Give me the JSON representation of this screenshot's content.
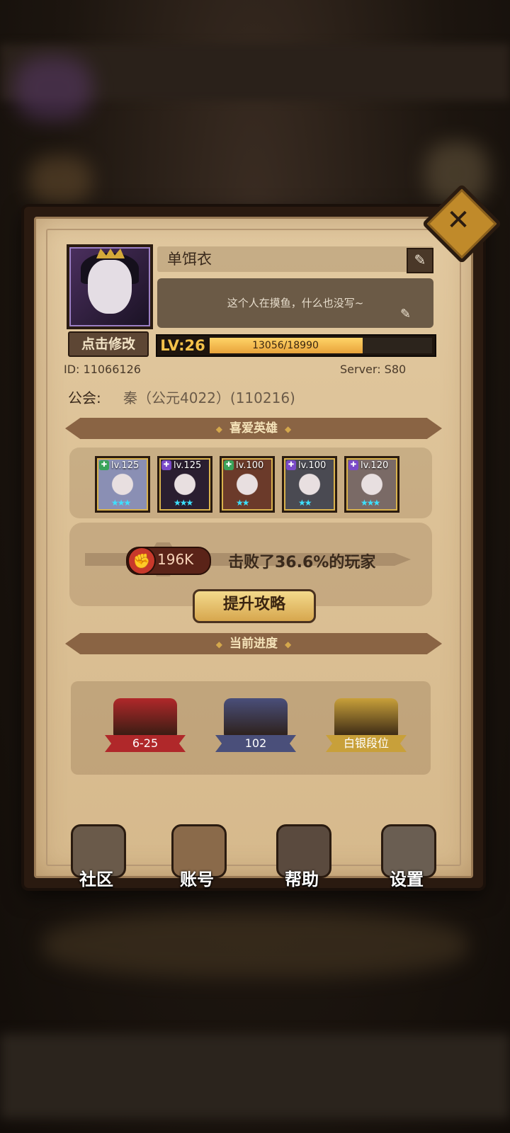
{
  "profile": {
    "name": "单饵衣",
    "bio": "这个人在摸鱼，什么也没写~",
    "edit_avatar_label": "点击修改",
    "level_label": "LV:26",
    "xp_text": "13056/18990",
    "xp_current": 13056,
    "xp_max": 18990,
    "id_text": "ID: 11066126",
    "server_text": "Server: S80",
    "guild_label": "公会:",
    "guild_value": "秦（公元4022）(110216)"
  },
  "sections": {
    "favorite_heroes": "喜爱英雄",
    "current_progress": "当前进度"
  },
  "heroes": [
    {
      "level": "lv.125",
      "element_color": "#3aa35a",
      "art_color": "#8a8fb4",
      "stars": "★★★"
    },
    {
      "level": "lv.125",
      "element_color": "#7a4ac8",
      "art_color": "#2a1e30",
      "stars": "★★★"
    },
    {
      "level": "lv.100",
      "element_color": "#3aa35a",
      "art_color": "#6b3a2a",
      "stars": "★★"
    },
    {
      "level": "lv.100",
      "element_color": "#7a4ac8",
      "art_color": "#4a4a52",
      "stars": "★★"
    },
    {
      "level": "lv.120",
      "element_color": "#7a4ac8",
      "art_color": "#7a6a66",
      "stars": "★★★"
    }
  ],
  "power": {
    "value": "196K",
    "description": "击败了36.6%的玩家",
    "upgrade_label": "提升攻略"
  },
  "progress": [
    {
      "label": "6-25",
      "color": "#b0282a"
    },
    {
      "label": "102",
      "color": "#4a4f7a"
    },
    {
      "label": "白银段位",
      "color": "#c8a03a"
    }
  ],
  "nav": [
    {
      "label": "社区",
      "icon": "castle-icon"
    },
    {
      "label": "账号",
      "icon": "account-card-icon"
    },
    {
      "label": "帮助",
      "icon": "speech-bubble-icon"
    },
    {
      "label": "设置",
      "icon": "gear-icon"
    }
  ]
}
